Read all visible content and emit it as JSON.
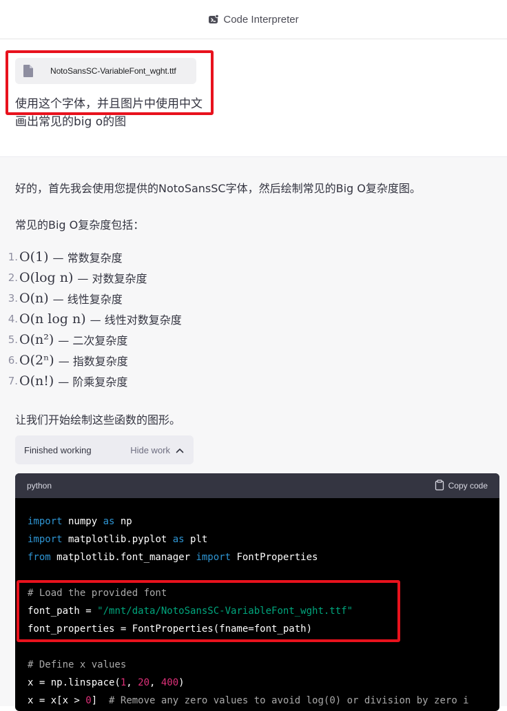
{
  "header": {
    "title": "Code Interpreter",
    "icon": "code-interpreter-icon"
  },
  "user_message": {
    "attachment": {
      "file_name": "NotoSansSC-VariableFont_wght.ttf",
      "icon": "file-icon"
    },
    "text_line1": "使用这个字体，并且图片中使用中文",
    "text_line2": "画出常见的big o的图"
  },
  "assistant_message": {
    "intro": "好的，首先我会使用您提供的NotoSansSC字体，然后绘制常见的Big O复杂度图。",
    "list_heading": "常见的Big O复杂度包括：",
    "items": [
      {
        "num": "1.",
        "formula": "O(1)",
        "desc": "— 常数复杂度"
      },
      {
        "num": "2.",
        "formula": "O(log n)",
        "desc": "— 对数复杂度"
      },
      {
        "num": "3.",
        "formula": "O(n)",
        "desc": "— 线性复杂度"
      },
      {
        "num": "4.",
        "formula": "O(n log n)",
        "desc": "— 线性对数复杂度"
      },
      {
        "num": "5.",
        "formula": "O(n²)",
        "desc": "— 二次复杂度"
      },
      {
        "num": "6.",
        "formula": "O(2ⁿ)",
        "desc": "— 指数复杂度"
      },
      {
        "num": "7.",
        "formula": "O(n!)",
        "desc": "— 阶乘复杂度"
      }
    ],
    "outro": "让我们开始绘制这些函数的图形。"
  },
  "work_panel": {
    "status": "Finished working",
    "toggle_label": "Hide work"
  },
  "code_block": {
    "language": "python",
    "copy_label": "Copy code",
    "lines": [
      {
        "t": [
          [
            "import",
            "kw"
          ],
          [
            " numpy ",
            ""
          ],
          [
            "as",
            "kw"
          ],
          [
            " np",
            ""
          ]
        ]
      },
      {
        "t": [
          [
            "import",
            "kw"
          ],
          [
            " matplotlib.pyplot ",
            ""
          ],
          [
            "as",
            "kw"
          ],
          [
            " plt",
            ""
          ]
        ]
      },
      {
        "t": [
          [
            "from",
            "kw"
          ],
          [
            " matplotlib.font_manager ",
            ""
          ],
          [
            "import",
            "kw"
          ],
          [
            " FontProperties",
            ""
          ]
        ]
      },
      {
        "t": []
      },
      {
        "t": [
          [
            "# Load the provided font",
            "cmt"
          ]
        ]
      },
      {
        "t": [
          [
            "font_path = ",
            ""
          ],
          [
            "\"/mnt/data/NotoSansSC-VariableFont_wght.ttf\"",
            "str"
          ]
        ]
      },
      {
        "t": [
          [
            "font_properties = FontProperties(fname=font_path)",
            ""
          ]
        ]
      },
      {
        "t": []
      },
      {
        "t": [
          [
            "# Define x values",
            "cmt"
          ]
        ]
      },
      {
        "t": [
          [
            "x = np.linspace(",
            ""
          ],
          [
            "1",
            "num-lit"
          ],
          [
            ", ",
            ""
          ],
          [
            "20",
            "num-lit"
          ],
          [
            ", ",
            ""
          ],
          [
            "400",
            "num-lit"
          ],
          [
            ")",
            ""
          ]
        ]
      },
      {
        "t": [
          [
            "x = x[x > ",
            ""
          ],
          [
            "0",
            "num-lit"
          ],
          [
            "]  ",
            ""
          ],
          [
            "# Remove any zero values to avoid log(0) or division by zero i",
            "cmt"
          ]
        ]
      }
    ]
  },
  "colors": {
    "highlight_border": "#e8121d",
    "assistant_bg": "#f7f7f8",
    "code_bg": "#000000",
    "code_header_bg": "#343541"
  }
}
